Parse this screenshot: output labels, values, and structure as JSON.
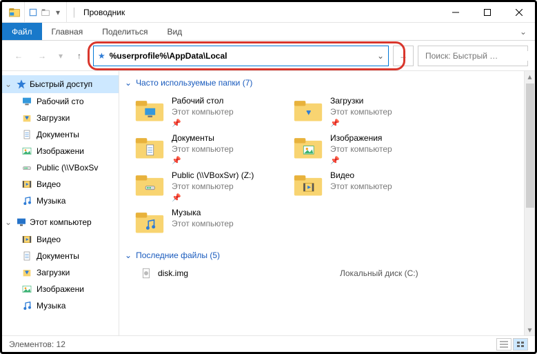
{
  "titlebar": {
    "title": "Проводник"
  },
  "ribbon": {
    "tabs": [
      "Файл",
      "Главная",
      "Поделиться",
      "Вид"
    ]
  },
  "address": {
    "path": "%userprofile%\\AppData\\Local"
  },
  "search": {
    "placeholder": "Поиск: Быстрый …"
  },
  "sidebar": {
    "quick_access": {
      "label": "Быстрый доступ",
      "items": [
        {
          "label": "Рабочий сто",
          "icon": "desktop"
        },
        {
          "label": "Загрузки",
          "icon": "downloads"
        },
        {
          "label": "Документы",
          "icon": "documents"
        },
        {
          "label": "Изображени",
          "icon": "pictures"
        },
        {
          "label": "Public (\\\\VBoxSv",
          "icon": "network"
        },
        {
          "label": "Видео",
          "icon": "video"
        },
        {
          "label": "Музыка",
          "icon": "music"
        }
      ]
    },
    "this_pc": {
      "label": "Этот компьютер",
      "items": [
        {
          "label": "Видео",
          "icon": "video"
        },
        {
          "label": "Документы",
          "icon": "documents"
        },
        {
          "label": "Загрузки",
          "icon": "downloads"
        },
        {
          "label": "Изображени",
          "icon": "pictures"
        },
        {
          "label": "Музыка",
          "icon": "music"
        }
      ]
    }
  },
  "content": {
    "frequent": {
      "label": "Часто используемые папки (7)",
      "items": [
        {
          "name": "Рабочий стол",
          "sub": "Этот компьютер",
          "pinned": true,
          "icon": "desktop"
        },
        {
          "name": "Загрузки",
          "sub": "Этот компьютер",
          "pinned": true,
          "icon": "downloads"
        },
        {
          "name": "Документы",
          "sub": "Этот компьютер",
          "pinned": true,
          "icon": "documents"
        },
        {
          "name": "Изображения",
          "sub": "Этот компьютер",
          "pinned": true,
          "icon": "pictures"
        },
        {
          "name": "Public (\\\\VBoxSvr) (Z:)",
          "sub": "Этот компьютер",
          "pinned": true,
          "icon": "network"
        },
        {
          "name": "Видео",
          "sub": "Этот компьютер",
          "pinned": false,
          "icon": "video"
        },
        {
          "name": "Музыка",
          "sub": "Этот компьютер",
          "pinned": false,
          "icon": "music"
        }
      ]
    },
    "recent": {
      "label": "Последние файлы (5)",
      "items": [
        {
          "name": "disk.img",
          "location": "Локальный диск (C:)"
        }
      ]
    }
  },
  "status": {
    "items": "Элементов: 12"
  }
}
